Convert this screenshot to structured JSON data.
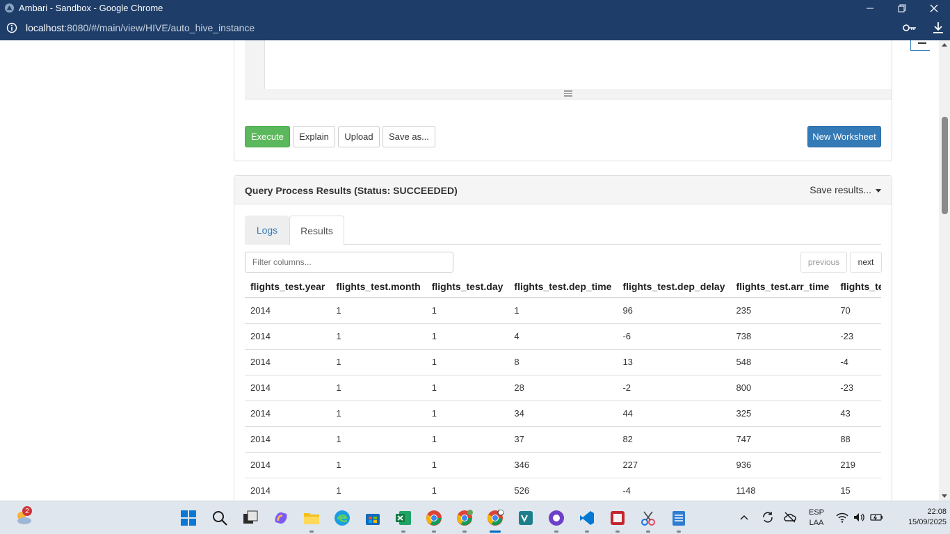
{
  "window": {
    "title": "Ambari - Sandbox - Google Chrome",
    "url_host": "localhost",
    "url_path": ":8080/#/main/view/HIVE/auto_hive_instance"
  },
  "toolbar": {
    "execute_label": "Execute",
    "explain_label": "Explain",
    "upload_label": "Upload",
    "save_as_label": "Save as...",
    "new_worksheet_label": "New Worksheet"
  },
  "results": {
    "title": "Query Process Results (Status: SUCCEEDED)",
    "save_results_label": "Save results...",
    "tabs": [
      {
        "label": "Logs",
        "active": false
      },
      {
        "label": "Results",
        "active": true
      }
    ],
    "filter_placeholder": "Filter columns...",
    "previous_label": "previous",
    "next_label": "next",
    "columns": [
      "flights_test.year",
      "flights_test.month",
      "flights_test.day",
      "flights_test.dep_time",
      "flights_test.dep_delay",
      "flights_test.arr_time",
      "flights_test.arr_delay"
    ],
    "rows": [
      [
        "2014",
        "1",
        "1",
        "1",
        "96",
        "235",
        "70"
      ],
      [
        "2014",
        "1",
        "1",
        "4",
        "-6",
        "738",
        "-23"
      ],
      [
        "2014",
        "1",
        "1",
        "8",
        "13",
        "548",
        "-4"
      ],
      [
        "2014",
        "1",
        "1",
        "28",
        "-2",
        "800",
        "-23"
      ],
      [
        "2014",
        "1",
        "1",
        "34",
        "44",
        "325",
        "43"
      ],
      [
        "2014",
        "1",
        "1",
        "37",
        "82",
        "747",
        "88"
      ],
      [
        "2014",
        "1",
        "1",
        "346",
        "227",
        "936",
        "219"
      ],
      [
        "2014",
        "1",
        "1",
        "526",
        "-4",
        "1148",
        "15"
      ]
    ]
  },
  "taskbar": {
    "weather_badge": "2",
    "language": "ESP",
    "keyboard": "LAA",
    "time": "22:08",
    "date": "15/09/2025",
    "icons": [
      "weather-icon",
      "start-icon",
      "search-icon",
      "task-view-icon",
      "copilot-icon",
      "file-explorer-icon",
      "edge-icon",
      "store-icon",
      "excel-icon",
      "chrome-icon",
      "chrome-profile-icon",
      "chrome-active-icon",
      "visual-studio-icon",
      "github-desktop-icon",
      "vscode-icon",
      "app-icon",
      "snipping-tool-icon",
      "notepad-icon"
    ]
  },
  "colors": {
    "titlebar": "#1e3d68",
    "execute": "#5cb85c",
    "primary": "#337ab7",
    "taskbar": "#dfe6ee"
  }
}
